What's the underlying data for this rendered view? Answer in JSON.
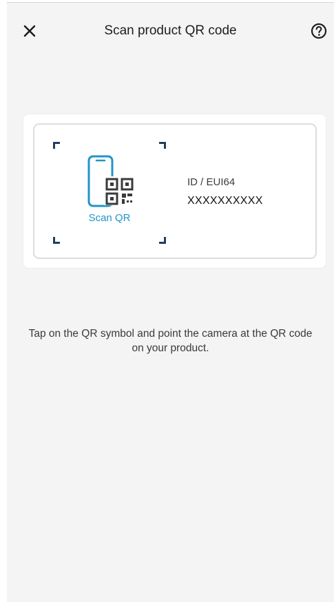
{
  "header": {
    "title": "Scan product QR code",
    "close_icon": "close-icon",
    "help_icon": "help-circle-icon"
  },
  "scan_card": {
    "scan_button_label": "Scan QR",
    "scan_icon": "phone-qr-icon",
    "id_label": "ID / EUI64",
    "id_value": "XXXXXXXXXX"
  },
  "instruction_text": "Tap on the QR symbol and point the camera at the QR code on your product.",
  "colors": {
    "background": "#f4f4f5",
    "accent": "#1f95c8",
    "corner_marks": "#1f3f5f",
    "qr_dark": "#3a3a3c"
  }
}
